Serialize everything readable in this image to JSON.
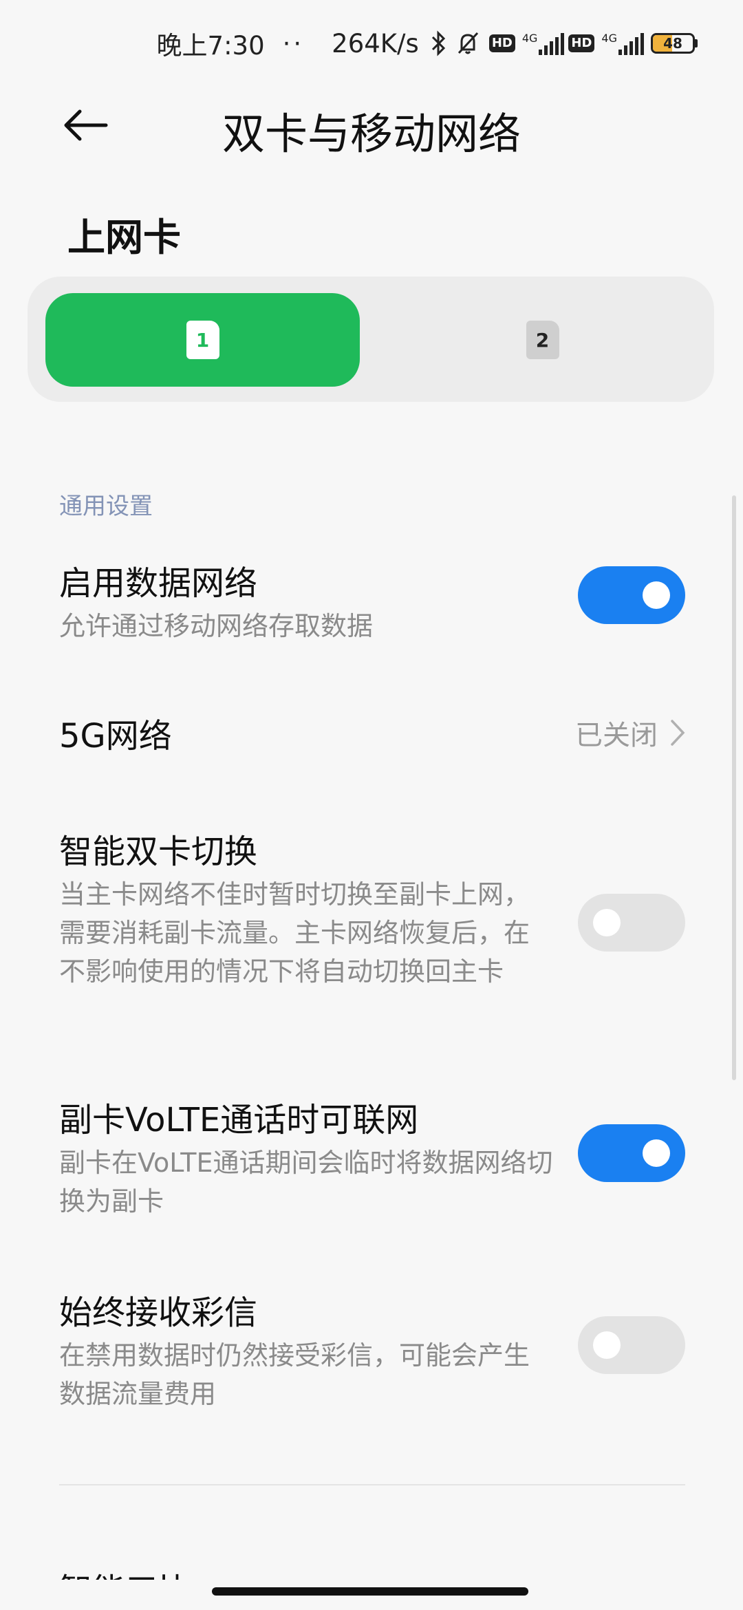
{
  "status_bar": {
    "time": "晚上7:30",
    "dots": "··",
    "speed": "264K/s",
    "hd_label": "HD",
    "net1": "4G",
    "net2": "4G",
    "battery": "48"
  },
  "header": {
    "title": "双卡与移动网络"
  },
  "data_card": {
    "label": "上网卡",
    "sim1": "1",
    "sim2": "2",
    "selected": "1"
  },
  "general": {
    "label": "通用设置",
    "rows": [
      {
        "title": "启用数据网络",
        "subtitle": "允许通过移动网络存取数据",
        "toggle": "on"
      },
      {
        "title": "5G网络",
        "value": "已关闭"
      },
      {
        "title": "智能双卡切换",
        "subtitle": "当主卡网络不佳时暂时切换至副卡上网，需要消耗副卡流量。主卡网络恢复后，在不影响使用的情况下将自动切换回主卡",
        "toggle": "off"
      },
      {
        "title": "副卡VoLTE通话时可联网",
        "subtitle": "副卡在VoLTE通话期间会临时将数据网络切换为副卡",
        "toggle": "on"
      },
      {
        "title": "始终接收彩信",
        "subtitle": "在禁用数据时仍然接受彩信，可能会产生数据流量费用",
        "toggle": "off"
      }
    ]
  },
  "next_section_partial": "智能五比"
}
